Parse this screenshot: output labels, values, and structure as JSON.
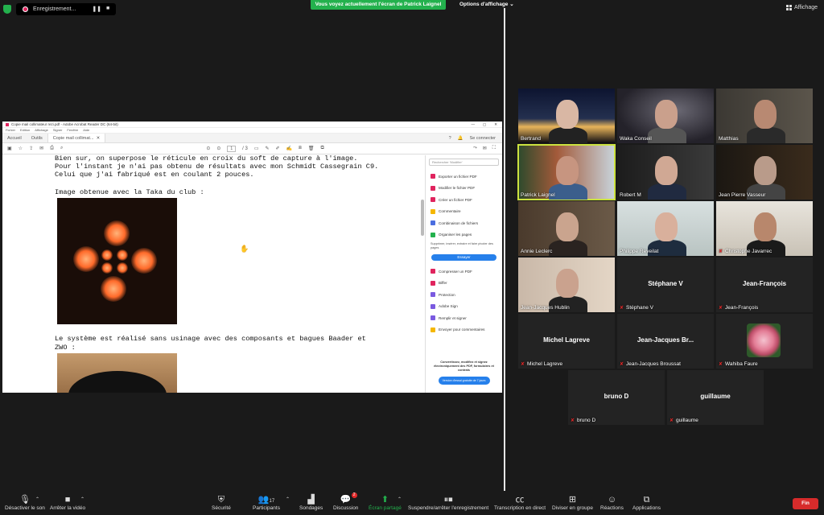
{
  "top": {
    "recording_label": "Enregistrement...",
    "share_banner": "Vous voyez actuellement l'écran de Patrick Laignel",
    "view_options": "Options d'affichage",
    "affichage": "Affichage"
  },
  "acrobat": {
    "title": "Copie mail collimateur rezi.pdf - Adobe Acrobat Reader DC (64-bit)",
    "menu": [
      "Fichier",
      "Edition",
      "Affichage",
      "Signer",
      "Fenêtre",
      "Aide"
    ],
    "tabs": [
      "Accueil",
      "Outils",
      "Copie mail collimat..."
    ],
    "signin": "Se connecter",
    "page_current": "1",
    "page_total": "/ 3",
    "doc_lines": [
      "Bien sur, on superpose le réticule en croix du soft de capture à l'image.",
      "Pour l'instant je n'ai pas obtenu de résultats avec mon Schmidt Cassegrain C9.",
      "Celui que j'ai fabriqué est en coulant 2 pouces.",
      "Image obtenue avec la Taka du club :",
      "Le système est réalisé sans usinage avec des composants et bagues Baader et",
      "ZWO :"
    ],
    "search_placeholder": "Rechercher 'Modifier'",
    "tools": [
      {
        "label": "Exporter un fichier PDF",
        "color": "#e0245e"
      },
      {
        "label": "Modifier le fichier PDF",
        "color": "#e0245e"
      },
      {
        "label": "Créer un fichier PDF",
        "color": "#e0245e"
      },
      {
        "label": "Commentaire",
        "color": "#f5b700"
      },
      {
        "label": "Combinaison de fichiers",
        "color": "#4b6ee0"
      },
      {
        "label": "Organiser les pages",
        "color": "#23b14d"
      }
    ],
    "organise_note": "Supprimer, insérer, extraire et faire pivoter des pages",
    "try_button": "Essayer",
    "tools2": [
      {
        "label": "Compresser un PDF",
        "color": "#e0245e"
      },
      {
        "label": "Biffer",
        "color": "#e0245e"
      },
      {
        "label": "Protection",
        "color": "#7a5ae0"
      },
      {
        "label": "Adobe Sign",
        "color": "#7a5ae0"
      },
      {
        "label": "Remplir et signer",
        "color": "#7a5ae0"
      },
      {
        "label": "Envoyer pour commentaires",
        "color": "#f5b700"
      }
    ],
    "promo_text": "Convertissez, modifiez et signez électroniquement des PDF, formulaires et contrats",
    "promo_button": "Version d'essai gratuite de 7 jours"
  },
  "participants": [
    {
      "name": "Bertrand",
      "muted": false,
      "video": true
    },
    {
      "name": "Waka Conseil",
      "muted": false,
      "video": true
    },
    {
      "name": "Matthias",
      "muted": false,
      "video": true
    },
    {
      "name": "Patrick Laignel",
      "muted": false,
      "video": true,
      "active": true
    },
    {
      "name": "Robert M",
      "muted": false,
      "video": true
    },
    {
      "name": "Jean Pierre Vasseur",
      "muted": false,
      "video": true
    },
    {
      "name": "Annie Leclerc",
      "muted": false,
      "video": true
    },
    {
      "name": "Philippe Reveilat",
      "muted": false,
      "video": true
    },
    {
      "name": "Christophe Javarrec",
      "muted": true,
      "video": true
    },
    {
      "name": "Jean-Jacques Hublin",
      "muted": false,
      "video": true
    },
    {
      "name": "Stéphane V",
      "muted": true,
      "video": false,
      "big": "Stéphane V"
    },
    {
      "name": "Jean-François",
      "muted": true,
      "video": false,
      "big": "Jean-François"
    },
    {
      "name": "Michel Lagreve",
      "muted": true,
      "video": false,
      "big": "Michel Lagreve"
    },
    {
      "name": "Jean-Jacques Broussat",
      "muted": true,
      "video": false,
      "big": "Jean-Jacques  Br..."
    },
    {
      "name": "Wahiba Faure",
      "muted": true,
      "video": true
    },
    {
      "name": "bruno D",
      "muted": true,
      "video": false,
      "big": "bruno D"
    },
    {
      "name": "guillaume",
      "muted": true,
      "video": false,
      "big": "guillaume"
    }
  ],
  "bottom": {
    "mute": "Désactiver le son",
    "video": "Arrêter la vidéo",
    "security": "Sécurité",
    "participants": "Participants",
    "participants_count": "17",
    "polls": "Sondages",
    "chat": "Discussion",
    "chat_badge": "2",
    "share": "Écran partagé",
    "record": "Suspendre/arrêter l'enregistrement",
    "transcript": "Transcription en direct",
    "breakout": "Diviser en groupe",
    "reactions": "Réactions",
    "apps": "Applications",
    "end": "Fin"
  }
}
